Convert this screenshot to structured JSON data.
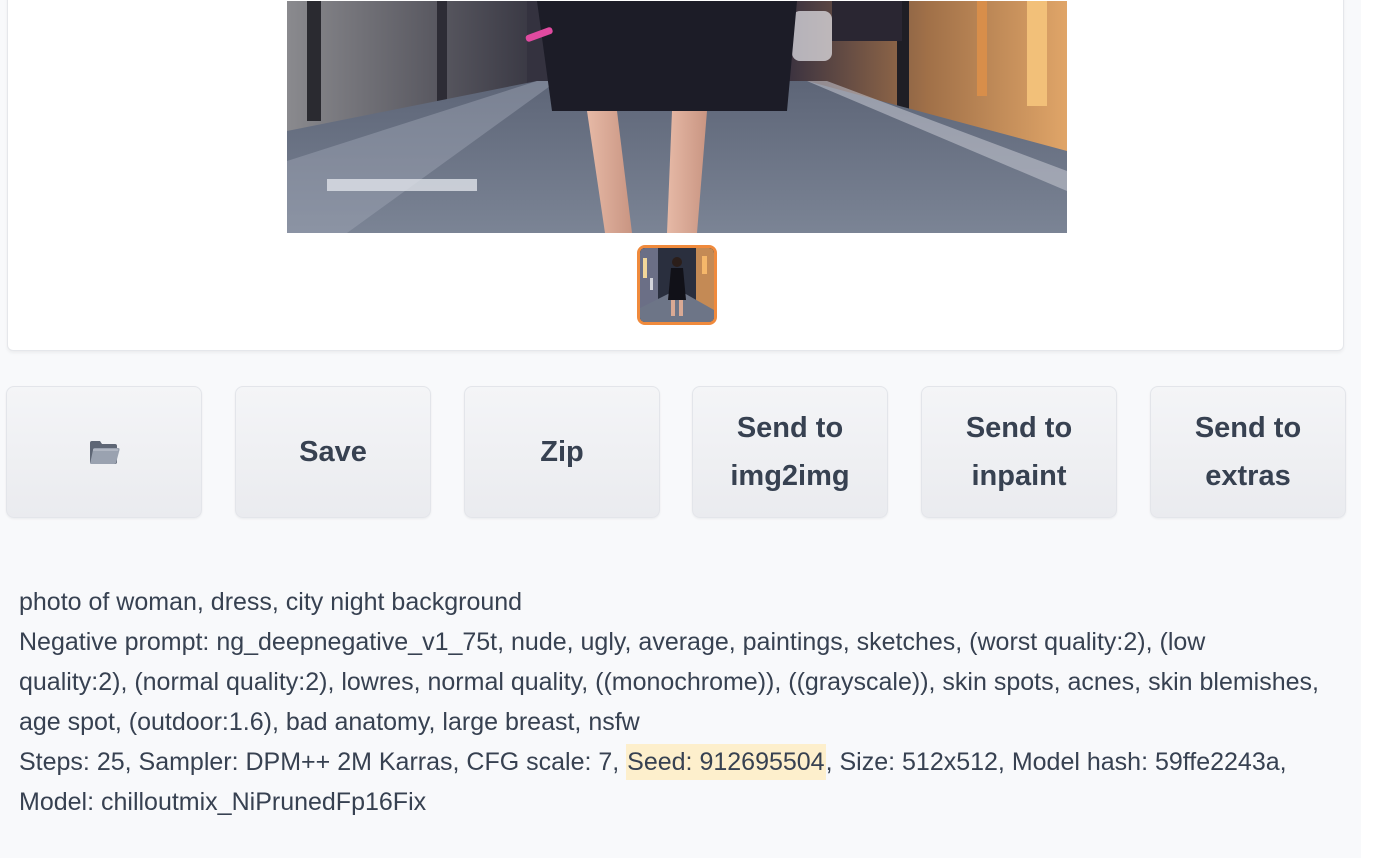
{
  "gallery": {
    "main_image_icon": "generated-photo",
    "thumbnail_icon": "generated-photo-thumbnail",
    "selected_border_color": "#f08a3c"
  },
  "actions": {
    "open_folder_icon": "folder-icon",
    "save_label": "Save",
    "zip_label": "Zip",
    "send_img2img_label": "Send to img2img",
    "send_inpaint_label": "Send to inpaint",
    "send_extras_label": "Send to extras"
  },
  "generation_info": {
    "prompt": "photo of woman, dress, city night background",
    "negative_prompt": "Negative prompt: ng_deepnegative_v1_75t, nude, ugly, average, paintings, sketches, (worst quality:2), (low quality:2), (normal quality:2), lowres, normal quality, ((monochrome)), ((grayscale)), skin spots, acnes, skin blemishes, age spot, (outdoor:1.6), bad anatomy, large breast, nsfw",
    "params_before_seed": "Steps: 25, Sampler: DPM++ 2M Karras, CFG scale: 7, ",
    "seed": "Seed: 912695504",
    "params_after_seed": ", Size: 512x512, Model hash: 59ffe2243a, Model: chilloutmix_NiPrunedFp16Fix",
    "seed_highlight_color": "#fdefcc"
  }
}
